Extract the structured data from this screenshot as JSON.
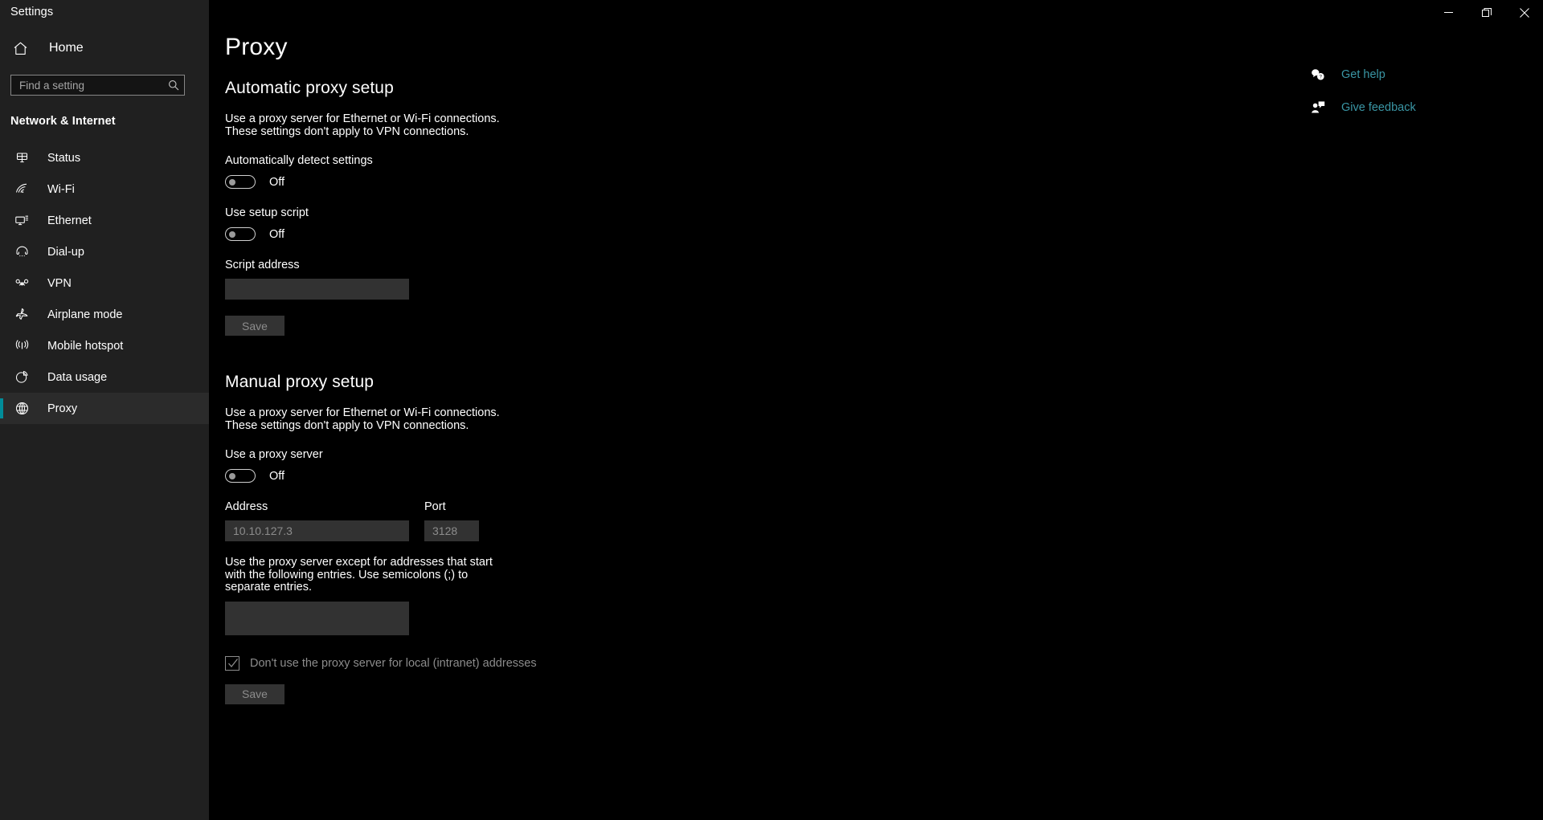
{
  "window": {
    "title": "Settings",
    "controls": [
      {
        "name": "minimize",
        "label": "Minimize"
      },
      {
        "name": "restore",
        "label": "Restore"
      },
      {
        "name": "close",
        "label": "Close"
      }
    ]
  },
  "accent_color": "#008c99",
  "link_color": "#3a96a5",
  "sidebar": {
    "home_label": "Home",
    "home_icon": "home-icon",
    "search": {
      "placeholder": "Find a setting",
      "value": "",
      "icon": "search-icon"
    },
    "group_title": "Network & Internet",
    "items": [
      {
        "label": "Status",
        "icon": "status-icon",
        "selected": false
      },
      {
        "label": "Wi-Fi",
        "icon": "wifi-icon",
        "selected": false
      },
      {
        "label": "Ethernet",
        "icon": "ethernet-icon",
        "selected": false
      },
      {
        "label": "Dial-up",
        "icon": "dialup-icon",
        "selected": false
      },
      {
        "label": "VPN",
        "icon": "vpn-icon",
        "selected": false
      },
      {
        "label": "Airplane mode",
        "icon": "airplane-icon",
        "selected": false
      },
      {
        "label": "Mobile hotspot",
        "icon": "hotspot-icon",
        "selected": false
      },
      {
        "label": "Data usage",
        "icon": "data-usage-icon",
        "selected": false
      },
      {
        "label": "Proxy",
        "icon": "globe-icon",
        "selected": true
      }
    ]
  },
  "main": {
    "page_title": "Proxy",
    "automatic": {
      "heading": "Automatic proxy setup",
      "description": "Use a proxy server for Ethernet or Wi-Fi connections. These settings don't apply to VPN connections.",
      "auto_detect_label": "Automatically detect settings",
      "auto_detect_state": "Off",
      "setup_script_label": "Use setup script",
      "setup_script_state": "Off",
      "script_address_label": "Script address",
      "script_address_value": "",
      "save_label": "Save"
    },
    "manual": {
      "heading": "Manual proxy setup",
      "description": "Use a proxy server for Ethernet or Wi-Fi connections. These settings don't apply to VPN connections.",
      "use_proxy_label": "Use a proxy server",
      "use_proxy_state": "Off",
      "address_label": "Address",
      "address_value": "10.10.127.3",
      "port_label": "Port",
      "port_value": "3128",
      "exceptions_description": "Use the proxy server except for addresses that start with the following entries. Use semicolons (;) to separate entries.",
      "exceptions_value": "",
      "bypass_local_label": "Don't use the proxy server for local (intranet) addresses",
      "bypass_local_checked": true,
      "save_label": "Save"
    }
  },
  "rail": {
    "items": [
      {
        "label": "Get help",
        "icon": "help-icon"
      },
      {
        "label": "Give feedback",
        "icon": "feedback-icon"
      }
    ]
  }
}
